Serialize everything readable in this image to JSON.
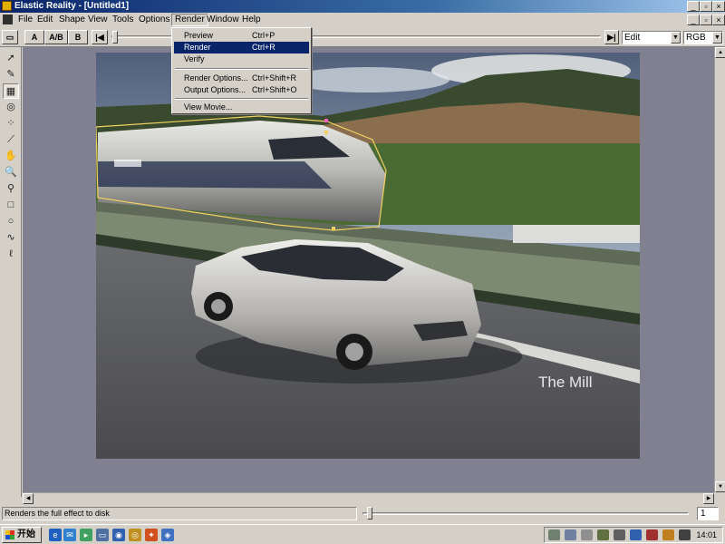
{
  "window": {
    "title": "Elastic Reality - [Untitled1]"
  },
  "menubar": {
    "items": [
      {
        "label": "File"
      },
      {
        "label": "Edit"
      },
      {
        "label": "Shape"
      },
      {
        "label": "View"
      },
      {
        "label": "Tools"
      },
      {
        "label": "Options"
      },
      {
        "label": "Render"
      },
      {
        "label": "Window"
      },
      {
        "label": "Help"
      }
    ]
  },
  "toolbar": {
    "btn_a": "A",
    "btn_ab": "A/B",
    "btn_b": "B",
    "mode_select": "Edit",
    "color_select": "RGB"
  },
  "render_menu": {
    "items": [
      {
        "label": "Preview",
        "shortcut": "Ctrl+P"
      },
      {
        "label": "Render",
        "shortcut": "Ctrl+R"
      },
      {
        "label": "Verify",
        "shortcut": ""
      },
      {
        "label": "Render Options...",
        "shortcut": "Ctrl+Shift+R"
      },
      {
        "label": "Output Options...",
        "shortcut": "Ctrl+Shift+O"
      },
      {
        "label": "View Movie...",
        "shortcut": ""
      }
    ],
    "highlighted": "Render"
  },
  "canvas": {
    "watermark": "The Mill"
  },
  "status": {
    "text": "Renders the full effect to disk",
    "frame": "1"
  },
  "taskbar": {
    "start_label": "开始",
    "clock": "14:01"
  },
  "colors": {
    "titlebar": "#0a246a",
    "menu_highlight": "#0a246a",
    "shape_outline": "#f0d060",
    "workspace": "#808090"
  }
}
